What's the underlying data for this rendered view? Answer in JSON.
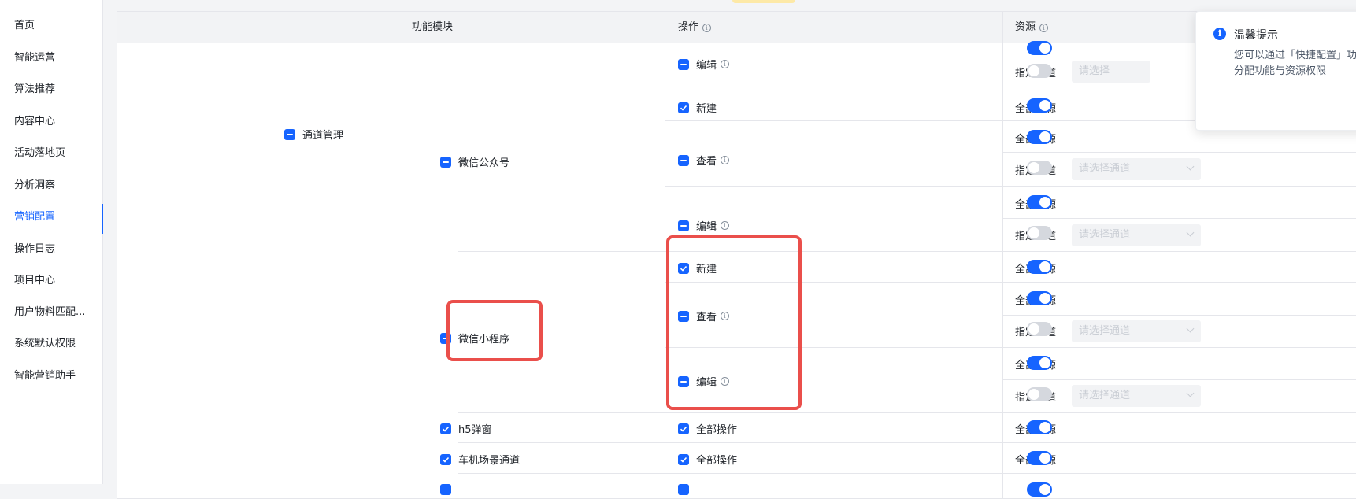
{
  "sidebar": {
    "items": [
      {
        "label": "首页"
      },
      {
        "label": "智能运营"
      },
      {
        "label": "算法推荐"
      },
      {
        "label": "内容中心"
      },
      {
        "label": "活动落地页"
      },
      {
        "label": "分析洞察"
      },
      {
        "label": "营销配置",
        "active": true
      },
      {
        "label": "操作日志"
      },
      {
        "label": "项目中心"
      },
      {
        "label": "用户物料匹配..."
      },
      {
        "label": "系统默认权限"
      },
      {
        "label": "智能营销助手"
      }
    ]
  },
  "table": {
    "headers": {
      "module": "功能模块",
      "action": "操作",
      "resource": "资源"
    },
    "group": {
      "label": "通道管理"
    },
    "submodules": {
      "wechat_official": "微信公众号",
      "wechat_mini": "微信小程序",
      "h5_popup": "h5弹窗",
      "car_channel": "车机场景通道"
    },
    "actions": {
      "create": "新建",
      "view": "查看",
      "edit": "编辑",
      "all_actions": "全部操作"
    },
    "resources": {
      "all": "全部资源",
      "specified": "指定通道",
      "select_placeholder": "请选择通道",
      "partial_placeholder": "请选择"
    }
  },
  "toast": {
    "title": "温馨提示",
    "line1": "您可以通过「快捷配置」功",
    "line2": "分配功能与资源权限"
  },
  "colors": {
    "accent": "#1664ff",
    "highlight": "#ea4f4b"
  }
}
